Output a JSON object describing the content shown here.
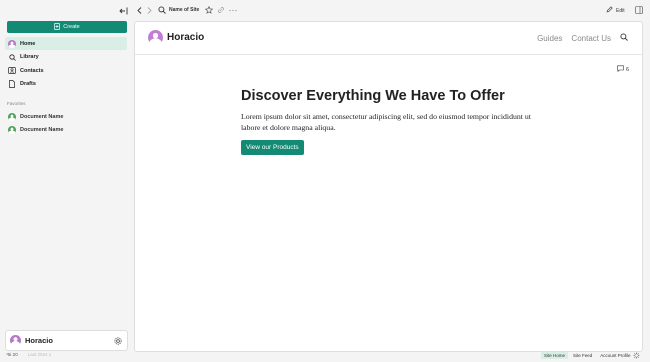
{
  "sidebar": {
    "create_label": "Create",
    "nav": [
      {
        "label": "Home",
        "icon": "avatar-icon",
        "active": true
      },
      {
        "label": "Library",
        "icon": "search-icon"
      },
      {
        "label": "Contacts",
        "icon": "contact-card-icon"
      },
      {
        "label": "Drafts",
        "icon": "document-icon"
      }
    ],
    "favorites_title": "Favorites",
    "favorites": [
      {
        "label": "Document Name"
      },
      {
        "label": "Document Name"
      }
    ],
    "profile_name": "Horacio",
    "bottom_left": {
      "version": "⁴5i 20",
      "faint": "Last 2024 1"
    }
  },
  "topbar": {
    "site_name": "Name of Site",
    "edit_label": "Edit"
  },
  "site": {
    "title": "Horacio",
    "nav": [
      "Guides",
      "Contact Us"
    ],
    "comment_count": "6"
  },
  "hero": {
    "title": "Discover Everything We Have To Offer",
    "text": "Lorem ipsum dolor sit amet, consectetur adipiscing elit, sed do eiusmod tempor incididunt ut labore et dolore magna aliqua.",
    "button": "View our Products"
  },
  "footer": {
    "tabs": [
      "Site Home",
      "Site Feed",
      "Account Profile"
    ]
  },
  "colors": {
    "accent": "#138a74",
    "active_bg": "#d9efe6"
  }
}
